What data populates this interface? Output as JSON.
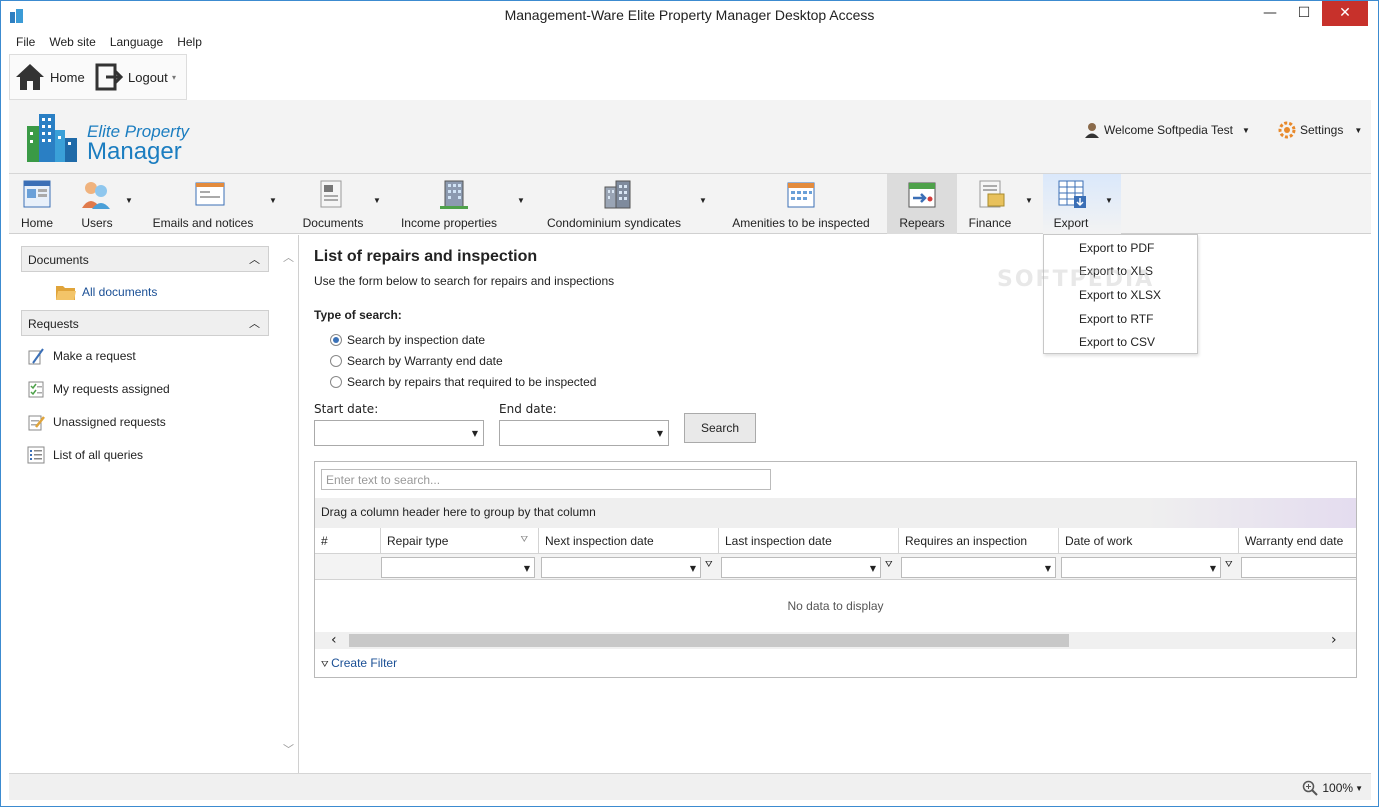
{
  "window": {
    "title": "Management-Ware Elite Property Manager Desktop Access",
    "minimize": "—",
    "maximize": "☐",
    "close": "✕"
  },
  "menu": [
    "File",
    "Web site",
    "Language",
    "Help"
  ],
  "toolbar": {
    "home_label": "Home",
    "logout_label": "Logout"
  },
  "logo": {
    "line1": "Elite Property",
    "line2": "Manager"
  },
  "user": {
    "welcome": "Welcome Softpedia Test",
    "settings": "Settings"
  },
  "ribbon": [
    {
      "label": "Home"
    },
    {
      "label": "Users"
    },
    {
      "label": "Emails and notices"
    },
    {
      "label": "Documents"
    },
    {
      "label": "Income properties"
    },
    {
      "label": "Condominium syndicates"
    },
    {
      "label": "Amenities to be inspected"
    },
    {
      "label": "Repears"
    },
    {
      "label": "Finance"
    },
    {
      "label": "Export"
    }
  ],
  "export_menu": [
    "Export to PDF",
    "Export to XLS",
    "Export to XLSX",
    "Export to RTF",
    "Export to CSV"
  ],
  "sidebar": {
    "documents_header": "Documents",
    "all_documents": "All documents",
    "requests_header": "Requests",
    "items": [
      "Make a request",
      "My requests assigned",
      "Unassigned requests",
      "List of all queries"
    ]
  },
  "main": {
    "title": "List of repairs and inspection",
    "subtitle": "Use the form below to search for repairs and inspections",
    "type_label": "Type of search:",
    "radios": [
      "Search by inspection date",
      "Search by Warranty end date",
      "Search by repairs that required to be inspected"
    ],
    "start_label": "Start date:",
    "end_label": "End date:",
    "search_button": "Search"
  },
  "grid": {
    "search_placeholder": "Enter text to search...",
    "group_hint": "Drag a column header here to group by that column",
    "columns": [
      "#",
      "Repair type",
      "Next inspection date",
      "Last inspection date",
      "Requires an inspection",
      "Date of work",
      "Warranty end date"
    ],
    "no_data": "No data to display",
    "create_filter": "Create Filter"
  },
  "status": {
    "zoom": "100%"
  },
  "watermark": "SOFTPEDIA"
}
